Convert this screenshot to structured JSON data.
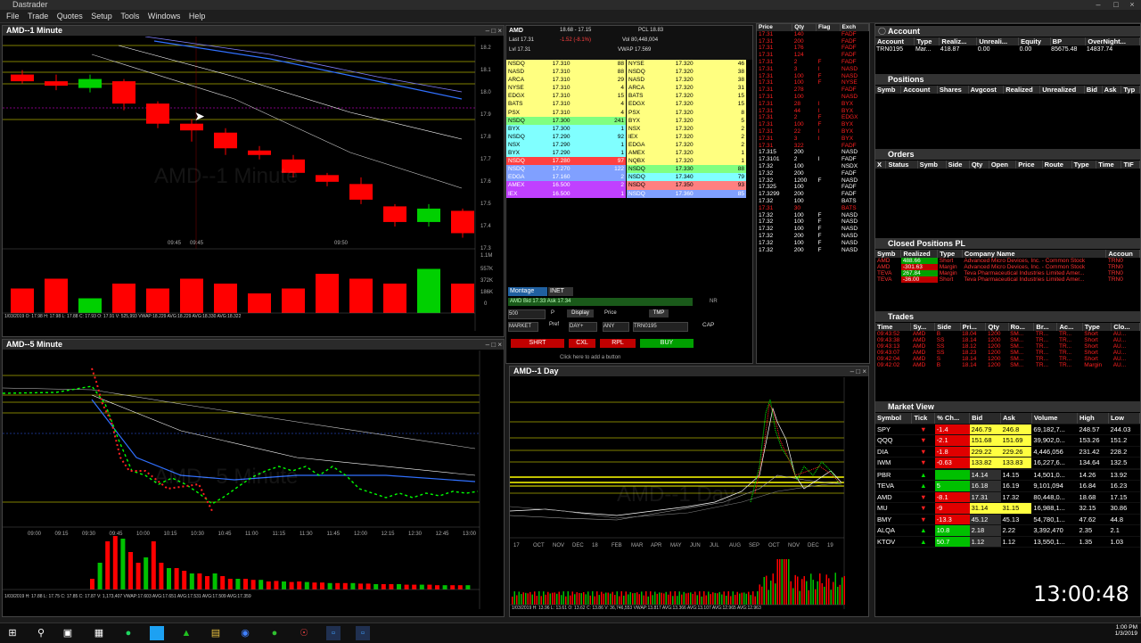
{
  "app": {
    "title": "Dastrader"
  },
  "menu": [
    "File",
    "Trade",
    "Quotes",
    "Setup",
    "Tools",
    "Windows",
    "Help"
  ],
  "chart1": {
    "title": "AMD--1 Minute",
    "watermark": "AMD--1 Minute",
    "x_ticks": [
      "09:45",
      "09:45",
      "09:50"
    ],
    "y_ticks": [
      "18.2",
      "18.1",
      "18.0",
      "17.9",
      "17.8",
      "17.7",
      "17.6",
      "17.5",
      "17.4",
      "17.3"
    ],
    "stats": "1/03/2019 O: 17.98 H: 17.98 L: 17.88 C: 17.93 O: 17.91 V: 525,993 VWAP:18.229 AVG:18.229 AVG:18.330 AVG:18.322",
    "candles": [
      {
        "o": 18.08,
        "c": 18.05,
        "h": 18.1,
        "l": 18.04
      },
      {
        "o": 18.05,
        "c": 18.03,
        "h": 18.08,
        "l": 18.01
      },
      {
        "o": 18.02,
        "c": 18.06,
        "h": 18.08,
        "l": 18.0
      },
      {
        "o": 18.05,
        "c": 17.95,
        "h": 18.06,
        "l": 17.92
      },
      {
        "o": 17.95,
        "c": 17.86,
        "h": 17.96,
        "l": 17.84
      },
      {
        "o": 17.86,
        "c": 17.83,
        "h": 17.88,
        "l": 17.78
      },
      {
        "o": 17.82,
        "c": 17.75,
        "h": 17.84,
        "l": 17.72
      },
      {
        "o": 17.74,
        "c": 17.72,
        "h": 17.76,
        "l": 17.7
      },
      {
        "o": 17.7,
        "c": 17.64,
        "h": 17.72,
        "l": 17.62
      },
      {
        "o": 17.63,
        "c": 17.6,
        "h": 17.64,
        "l": 17.58
      },
      {
        "o": 17.59,
        "c": 17.52,
        "h": 17.62,
        "l": 17.5
      },
      {
        "o": 17.49,
        "c": 17.42,
        "h": 17.5,
        "l": 17.4
      },
      {
        "o": 17.42,
        "c": 17.48,
        "h": 17.5,
        "l": 17.4
      },
      {
        "o": 17.47,
        "c": 17.37,
        "h": 17.48,
        "l": 17.35
      }
    ],
    "volume_ticks": [
      "1.1M",
      "557K",
      "372K",
      "186K",
      "0"
    ]
  },
  "chart5": {
    "title": "AMD--5 Minute",
    "watermark": "AMD--5 Minute",
    "x_ticks": [
      "09:00",
      "09:15",
      "09:30",
      "09:45",
      "10:00",
      "10:15",
      "10:30",
      "10:45",
      "11:00",
      "11:15",
      "11:30",
      "11:45",
      "12:00",
      "12:15",
      "12:30",
      "12:45",
      "13:00"
    ],
    "stats": "1/03/2019 H: 17.88 L: 17.75 C: 17.85 C: 17.87 V: 1,173,407 VWAP:17.603 AVG:17.651 AVG:17.531 AVG:17.509 AVG:17.359"
  },
  "montage": {
    "symbol": "AMD",
    "range": "18.68 - 17.15",
    "pcl": "PCL 18.83",
    "last": "Last 17.31",
    "change": "-1.52 (-8.1%)",
    "vol": "Vol 80,448,004",
    "lvl": "Lvl 17.31",
    "vwap": "VWAP 17.569",
    "bid_rows": [
      {
        "ex": "NSDQ",
        "price": "17.310",
        "size": "88",
        "bg": "#ffff80"
      },
      {
        "ex": "NASD",
        "price": "17.310",
        "size": "88",
        "bg": "#ffff80"
      },
      {
        "ex": "ARCA",
        "price": "17.310",
        "size": "29",
        "bg": "#ffff80"
      },
      {
        "ex": "NYSE",
        "price": "17.310",
        "size": "4",
        "bg": "#ffff80"
      },
      {
        "ex": "EDGX",
        "price": "17.310",
        "size": "15",
        "bg": "#ffff80"
      },
      {
        "ex": "BATS",
        "price": "17.310",
        "size": "4",
        "bg": "#ffff80"
      },
      {
        "ex": "PSX",
        "price": "17.310",
        "size": "4",
        "bg": "#ffff80"
      },
      {
        "ex": "NSDQ",
        "price": "17.300",
        "size": "241",
        "bg": "#80ff80"
      },
      {
        "ex": "BYX",
        "price": "17.300",
        "size": "1",
        "bg": "#80ffff"
      },
      {
        "ex": "NSDQ",
        "price": "17.290",
        "size": "92",
        "bg": "#80ffff"
      },
      {
        "ex": "NSX",
        "price": "17.290",
        "size": "1",
        "bg": "#80ffff"
      },
      {
        "ex": "BYX",
        "price": "17.290",
        "size": "1",
        "bg": "#80ffff"
      },
      {
        "ex": "NSDQ",
        "price": "17.280",
        "size": "97",
        "bg": "#ff8080"
      },
      {
        "ex": "NSDQ",
        "price": "17.270",
        "size": "122",
        "bg": "#80a0ff"
      },
      {
        "ex": "EDGA",
        "price": "17.160",
        "size": "2",
        "bg": "#80a0ff"
      },
      {
        "ex": "AMEX",
        "price": "16.500",
        "size": "2",
        "bg": "#c040ff"
      },
      {
        "ex": "IEX",
        "price": "16.500",
        "size": "1",
        "bg": "#c040ff"
      }
    ],
    "ask_rows": [
      {
        "ex": "NYSE",
        "price": "17.320",
        "size": "46",
        "bg": "#ffff80"
      },
      {
        "ex": "NSDQ",
        "price": "17.320",
        "size": "38",
        "bg": "#ffff80"
      },
      {
        "ex": "NASD",
        "price": "17.320",
        "size": "38",
        "bg": "#ffff80"
      },
      {
        "ex": "ARCA",
        "price": "17.320",
        "size": "31",
        "bg": "#ffff80"
      },
      {
        "ex": "BATS",
        "price": "17.320",
        "size": "15",
        "bg": "#ffff80"
      },
      {
        "ex": "EDGX",
        "price": "17.320",
        "size": "15",
        "bg": "#ffff80"
      },
      {
        "ex": "PSX",
        "price": "17.320",
        "size": "8",
        "bg": "#ffff80"
      },
      {
        "ex": "BYX",
        "price": "17.320",
        "size": "5",
        "bg": "#ffff80"
      },
      {
        "ex": "NSX",
        "price": "17.320",
        "size": "2",
        "bg": "#ffff80"
      },
      {
        "ex": "IEX",
        "price": "17.320",
        "size": "2",
        "bg": "#ffff80"
      },
      {
        "ex": "EDGA",
        "price": "17.320",
        "size": "2",
        "bg": "#ffff80"
      },
      {
        "ex": "AMEX",
        "price": "17.320",
        "size": "1",
        "bg": "#ffff80"
      },
      {
        "ex": "NQBX",
        "price": "17.320",
        "size": "1",
        "bg": "#ffff80"
      },
      {
        "ex": "NSDQ",
        "price": "17.330",
        "size": "88",
        "bg": "#80ff80"
      },
      {
        "ex": "NSDQ",
        "price": "17.340",
        "size": "79",
        "bg": "#80ffff"
      },
      {
        "ex": "NSDQ",
        "price": "17.350",
        "size": "93",
        "bg": "#ff8080"
      },
      {
        "ex": "NSDQ",
        "price": "17.360",
        "size": "85",
        "bg": "#80a0ff"
      }
    ],
    "tabs": [
      "Montage",
      "INET"
    ],
    "bid_ask_line": "AMD Bid 17.33 Ask 17.34",
    "qty": "500",
    "route": "DAY+",
    "account_sel": "TRN0195",
    "type_sel": "MARKET",
    "labels": {
      "p": "P",
      "display": "Display",
      "price": "Price",
      "tmp": "TMP",
      "pref": "Pref",
      "any": "ANY",
      "cap": "CAP",
      "nr": "NR"
    },
    "buttons": {
      "short": "SHRT",
      "cancel": "CXL",
      "replace": "RPL",
      "buy": "BUY"
    },
    "add_button_text": "Click here to add a button"
  },
  "time_sales": {
    "headers": [
      "Price",
      "Qty",
      "Flag",
      "Exch"
    ],
    "rows": [
      [
        "17.31",
        "140",
        "",
        "FADF"
      ],
      [
        "17.31",
        "200",
        "",
        "FADF"
      ],
      [
        "17.31",
        "176",
        "",
        "FADF"
      ],
      [
        "17.31",
        "124",
        "",
        "FADF"
      ],
      [
        "17.31",
        "2",
        "F",
        "FADF"
      ],
      [
        "17.31",
        "3",
        "I",
        "NASD"
      ],
      [
        "17.31",
        "100",
        "F",
        "NASD"
      ],
      [
        "17.31",
        "100",
        "F",
        "NYSE"
      ],
      [
        "17.31",
        "278",
        "",
        "FADF"
      ],
      [
        "17.31",
        "100",
        "",
        "NASD"
      ],
      [
        "17.31",
        "28",
        "I",
        "BYX"
      ],
      [
        "17.31",
        "44",
        "I",
        "BYX"
      ],
      [
        "17.31",
        "2",
        "F",
        "EDGX"
      ],
      [
        "17.31",
        "100",
        "F",
        "BYX"
      ],
      [
        "17.31",
        "22",
        "I",
        "BYX"
      ],
      [
        "17.31",
        "3",
        "I",
        "BYX"
      ],
      [
        "17.31",
        "322",
        "",
        "FADF"
      ],
      [
        "17.315",
        "200",
        "",
        "NASD"
      ],
      [
        "17.3101",
        "2",
        "I",
        "FADF"
      ],
      [
        "17.32",
        "100",
        "",
        "NSDX"
      ],
      [
        "17.32",
        "200",
        "",
        "FADF"
      ],
      [
        "17.32",
        "1200",
        "F",
        "NASD"
      ],
      [
        "17.325",
        "100",
        "",
        "FADF"
      ],
      [
        "17.3299",
        "200",
        "",
        "FADF"
      ],
      [
        "17.32",
        "100",
        "",
        "BATS"
      ],
      [
        "17.31",
        "30",
        "",
        "BATS"
      ],
      [
        "17.32",
        "100",
        "F",
        "NASD"
      ],
      [
        "17.32",
        "100",
        "F",
        "NASD"
      ],
      [
        "17.32",
        "100",
        "F",
        "NASD"
      ],
      [
        "17.32",
        "200",
        "F",
        "NASD"
      ],
      [
        "17.32",
        "100",
        "F",
        "NASD"
      ],
      [
        "17.32",
        "200",
        "F",
        "NASD"
      ]
    ]
  },
  "daily": {
    "title": "AMD--1 Day",
    "watermark": "AMD--1 Day",
    "x_ticks": [
      "17",
      "OCT",
      "NOV",
      "DEC",
      "18",
      "FEB",
      "MAR",
      "APR",
      "MAY",
      "JUN",
      "JUL",
      "AUG",
      "SEP",
      "OCT",
      "NOV",
      "DEC",
      "19"
    ],
    "stats": "1/03/2019 H: 13.96 L: 13.61 O: 13.62 C: 13.86 V: 36,746,553 VWAP:13.817 AVG:13.366 AVG:13.107 AVG:12.965 AVG:12.963"
  },
  "account": {
    "title": "Account",
    "headers": [
      "Account",
      "Type",
      "Realiz...",
      "Unreali...",
      "Equity",
      "BP",
      "OverNight..."
    ],
    "row": [
      "TRN0195",
      "Mar...",
      "418.87",
      "0.00",
      "0.00",
      "85675.48",
      "14837.74"
    ]
  },
  "positions": {
    "title": "Positions",
    "headers": [
      "Symb",
      "Account",
      "Shares",
      "Avgcost",
      "Realized",
      "Unrealized",
      "Bid",
      "Ask",
      "Typ"
    ]
  },
  "orders": {
    "title": "Orders",
    "headers": [
      "X",
      "Status",
      "Symb",
      "Side",
      "Qty",
      "Open",
      "Price",
      "Route",
      "Type",
      "Time",
      "TIF"
    ]
  },
  "closed": {
    "title": "Closed Positions PL",
    "headers": [
      "Symb",
      "Realized",
      "Type",
      "Company Name",
      "Accoun"
    ],
    "rows": [
      [
        "AMD",
        "488.66",
        "Short",
        "Advanced Micro Devices, Inc. - Common Stock",
        "TRN0"
      ],
      [
        "AMD",
        "-301.63",
        "Margin",
        "Advanced Micro Devices, Inc. - Common Stock",
        "TRN0"
      ],
      [
        "TEVA",
        "267.84",
        "Margin",
        "Teva Pharmaceutical Industries Limited Amer...",
        "TRN0"
      ],
      [
        "TEVA",
        "-36.00",
        "Short",
        "Teva Pharmaceutical Industries Limited Amer...",
        "TRN0"
      ]
    ]
  },
  "trades": {
    "title": "Trades",
    "headers": [
      "Time",
      "Sy...",
      "Side",
      "Pri...",
      "Qty",
      "Ro...",
      "Br...",
      "Ac...",
      "Type",
      "Clo..."
    ],
    "rows": [
      [
        "09:43:52",
        "AMD",
        "B",
        "18.04",
        "1200",
        "SM...",
        "TR...",
        "TR...",
        "Short",
        "AU..."
      ],
      [
        "09:43:38",
        "AMD",
        "SS",
        "18.14",
        "1200",
        "SM...",
        "TR...",
        "TR...",
        "Short",
        "AU..."
      ],
      [
        "09:43:13",
        "AMD",
        "SS",
        "18.12",
        "1200",
        "SM...",
        "TR...",
        "TR...",
        "Short",
        "AU..."
      ],
      [
        "09:43:07",
        "AMD",
        "SS",
        "18.23",
        "1200",
        "SM...",
        "TR...",
        "TR...",
        "Short",
        "AU..."
      ],
      [
        "09:42:04",
        "AMD",
        "S",
        "18.14",
        "1200",
        "SM...",
        "TR...",
        "TR...",
        "Short",
        "AU..."
      ],
      [
        "09:42:02",
        "AMD",
        "B",
        "18.14",
        "1200",
        "SM...",
        "TR...",
        "TR...",
        "Margin",
        "AU..."
      ]
    ]
  },
  "market_view": {
    "title": "Market View",
    "headers": [
      "Symbol",
      "Tick",
      "% Ch...",
      "Bid",
      "Ask",
      "Volume",
      "High",
      "Low"
    ],
    "rows": [
      {
        "sym": "SPY",
        "tick": "down",
        "pch": "-1.4",
        "bid": "246.79",
        "ask": "246.8",
        "vol": "69,182,7...",
        "high": "248.57",
        "low": "244.03",
        "pbg": "#e00000",
        "bbg": "#ffff40"
      },
      {
        "sym": "QQQ",
        "tick": "down",
        "pch": "-2.1",
        "bid": "151.68",
        "ask": "151.69",
        "vol": "39,902,0...",
        "high": "153.26",
        "low": "151.2",
        "pbg": "#e00000",
        "bbg": "#ffff40"
      },
      {
        "sym": "DIA",
        "tick": "down",
        "pch": "-1.8",
        "bid": "229.22",
        "ask": "229.26",
        "vol": "4,446,056",
        "high": "231.42",
        "low": "228.2",
        "pbg": "#e00000",
        "bbg": "#ffff40"
      },
      {
        "sym": "IWM",
        "tick": "down",
        "pch": "-0.63",
        "bid": "133.82",
        "ask": "133.83",
        "vol": "16,227,6...",
        "high": "134.64",
        "low": "132.5",
        "pbg": "#e00000",
        "bbg": "#ffff40"
      },
      {
        "sym": "",
        "tick": "",
        "pch": "",
        "bid": "",
        "ask": "",
        "vol": "",
        "high": "",
        "low": "",
        "pbg": "",
        "bbg": ""
      },
      {
        "sym": "PBR",
        "tick": "up",
        "pch": "",
        "bid": "14.14",
        "ask": "14.15",
        "vol": "14,501,0...",
        "high": "14.26",
        "low": "13.92",
        "pbg": "#00c000",
        "bbg": ""
      },
      {
        "sym": "TEVA",
        "tick": "up",
        "pch": "5",
        "bid": "16.18",
        "ask": "16.19",
        "vol": "9,101,094",
        "high": "16.84",
        "low": "16.23",
        "pbg": "#00c000",
        "bbg": ""
      },
      {
        "sym": "AMD",
        "tick": "down",
        "pch": "-8.1",
        "bid": "17.31",
        "ask": "17.32",
        "vol": "80,448,0...",
        "high": "18.68",
        "low": "17.15",
        "pbg": "#e00000",
        "bbg": ""
      },
      {
        "sym": "MU",
        "tick": "down",
        "pch": "-9",
        "bid": "31.14",
        "ask": "31.15",
        "vol": "16,988,1...",
        "high": "32.15",
        "low": "30.86",
        "pbg": "#e00000",
        "bbg": "#ffff40"
      },
      {
        "sym": "BMY",
        "tick": "down",
        "pch": "-13.3",
        "bid": "45.12",
        "ask": "45.13",
        "vol": "54,780,1...",
        "high": "47.62",
        "low": "44.8",
        "pbg": "#e00000",
        "bbg": ""
      },
      {
        "sym": "ALQA",
        "tick": "up",
        "pch": "10.8",
        "bid": "2.18",
        "ask": "2.22",
        "vol": "3,392,470",
        "high": "2.35",
        "low": "2.1",
        "pbg": "#00c000",
        "bbg": ""
      },
      {
        "sym": "KTOV",
        "tick": "up",
        "pch": "50.7",
        "bid": "1.12",
        "ask": "1.12",
        "vol": "13,550,1...",
        "high": "1.35",
        "low": "1.03",
        "pbg": "#00c000",
        "bbg": ""
      }
    ]
  },
  "clock": "13:00:48",
  "taskbar_clock": {
    "time": "1:00 PM",
    "date": "1/3/2019"
  }
}
